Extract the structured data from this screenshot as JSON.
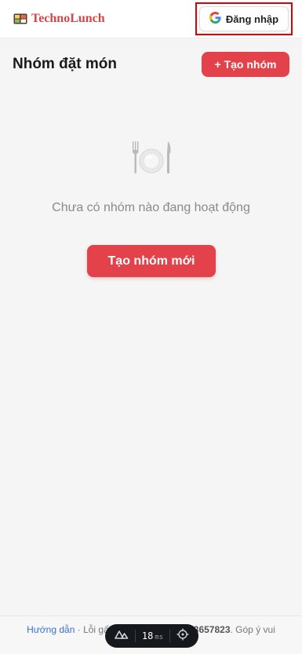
{
  "header": {
    "brand_name": "TechnoLunch",
    "login_label": "Đăng nhập"
  },
  "main": {
    "title": "Nhóm đặt món",
    "create_group_small_label": "+ Tạo nhóm",
    "empty_text": "Chưa có nhóm nào đang hoạt động",
    "create_group_big_label": "Tạo nhóm mới"
  },
  "footer": {
    "guide_link": "Hướng dẫn",
    "sep1": " · ",
    "bug_prefix": "Lỗi gấp, ",
    "phone_partial": "93657823",
    "sep2": ". ",
    "feedback_text": "Góp ý vui"
  },
  "devtools": {
    "time_value": "18",
    "time_unit": "ms"
  },
  "colors": {
    "accent": "#e3424a",
    "brand": "#d64545",
    "highlight_border": "#e00000",
    "link": "#3b6fd6"
  },
  "icons": {
    "brand": "bento-box-icon",
    "login": "google-g-icon",
    "empty": "plate-fork-knife-icon",
    "devtools_logo": "nuxt-icon",
    "devtools_inspect": "crosshair-icon"
  }
}
